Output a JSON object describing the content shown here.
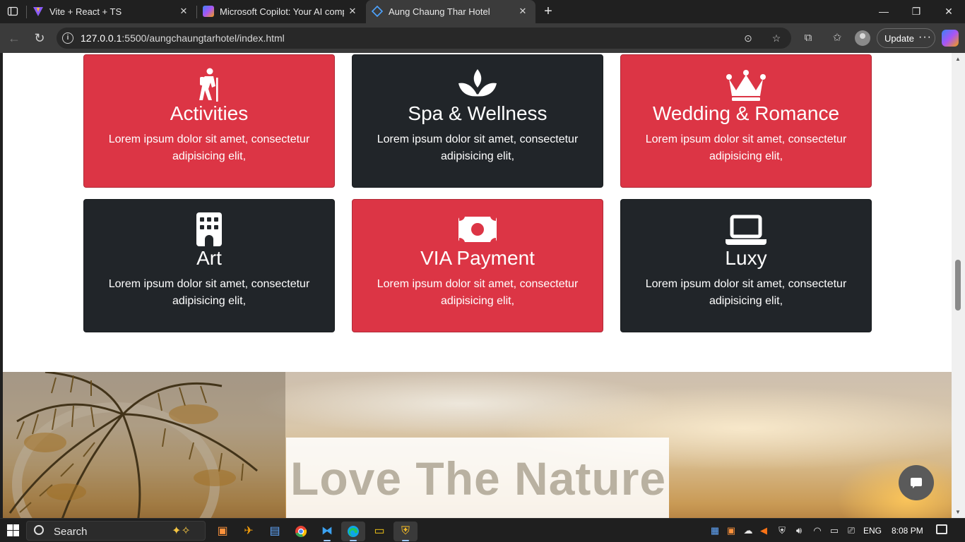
{
  "browser": {
    "tabs": [
      {
        "title": "Vite + React + TS",
        "favicon_color": "#8b5cf6"
      },
      {
        "title": "Microsoft Copilot: Your AI compa",
        "favicon_color": "#3b82f6"
      },
      {
        "title": "Aung Chaung Thar Hotel",
        "favicon_color": "#1e88e5"
      }
    ],
    "active_tab_index": 2,
    "url_host": "127.0.0.1",
    "url_rest": ":5500/aungchaungtarhotel/index.html",
    "update_label": "Update"
  },
  "services": [
    {
      "icon": "hiking-icon",
      "title": "Activities",
      "desc": "Lorem ipsum dolor sit amet, consectetur adipisicing elit,",
      "color": "#dc3545"
    },
    {
      "icon": "spa-icon",
      "title": "Spa & Wellness",
      "desc": "Lorem ipsum dolor sit amet, consectetur adipisicing elit,",
      "color": "#212529"
    },
    {
      "icon": "crown-icon",
      "title": "Wedding & Romance",
      "desc": "Lorem ipsum dolor sit amet, consectetur adipisicing elit,",
      "color": "#dc3545"
    },
    {
      "icon": "building-icon",
      "title": "Art",
      "desc": "Lorem ipsum dolor sit amet, consectetur adipisicing elit,",
      "color": "#212529"
    },
    {
      "icon": "money-bill-icon",
      "title": "VIA Payment",
      "desc": "Lorem ipsum dolor sit amet, consectetur adipisicing elit,",
      "color": "#dc3545"
    },
    {
      "icon": "laptop-icon",
      "title": "Luxy",
      "desc": "Lorem ipsum dolor sit amet, consectetur adipisicing elit,",
      "color": "#212529"
    }
  ],
  "hero": {
    "title": "Love The Nature"
  },
  "taskbar": {
    "search_label": "Search",
    "language": "ENG",
    "time": "8:08 PM"
  }
}
